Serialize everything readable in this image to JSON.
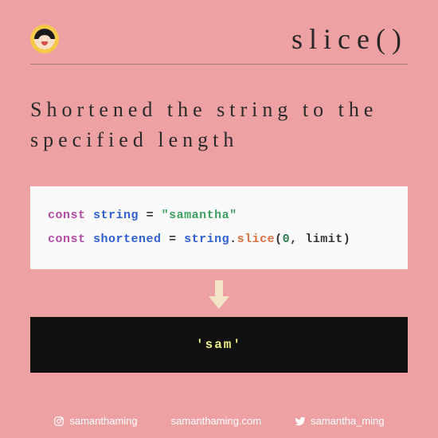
{
  "header": {
    "title": "slice()"
  },
  "subtitle": "Shortened the string to the specified length",
  "code": {
    "line1": {
      "const": "const",
      "var": "string",
      "eq": "=",
      "value": "\"samantha\""
    },
    "line2": {
      "const": "const",
      "var": "shortened",
      "eq": "=",
      "ref": "string",
      "dot": ".",
      "fn": "slice",
      "open": "(",
      "arg1": "0",
      "comma": ",",
      "arg2": "limit",
      "close": ")"
    }
  },
  "result": "'sam'",
  "footer": {
    "instagram": "samanthaming",
    "website": "samanthaming.com",
    "twitter": "samantha_ming"
  }
}
